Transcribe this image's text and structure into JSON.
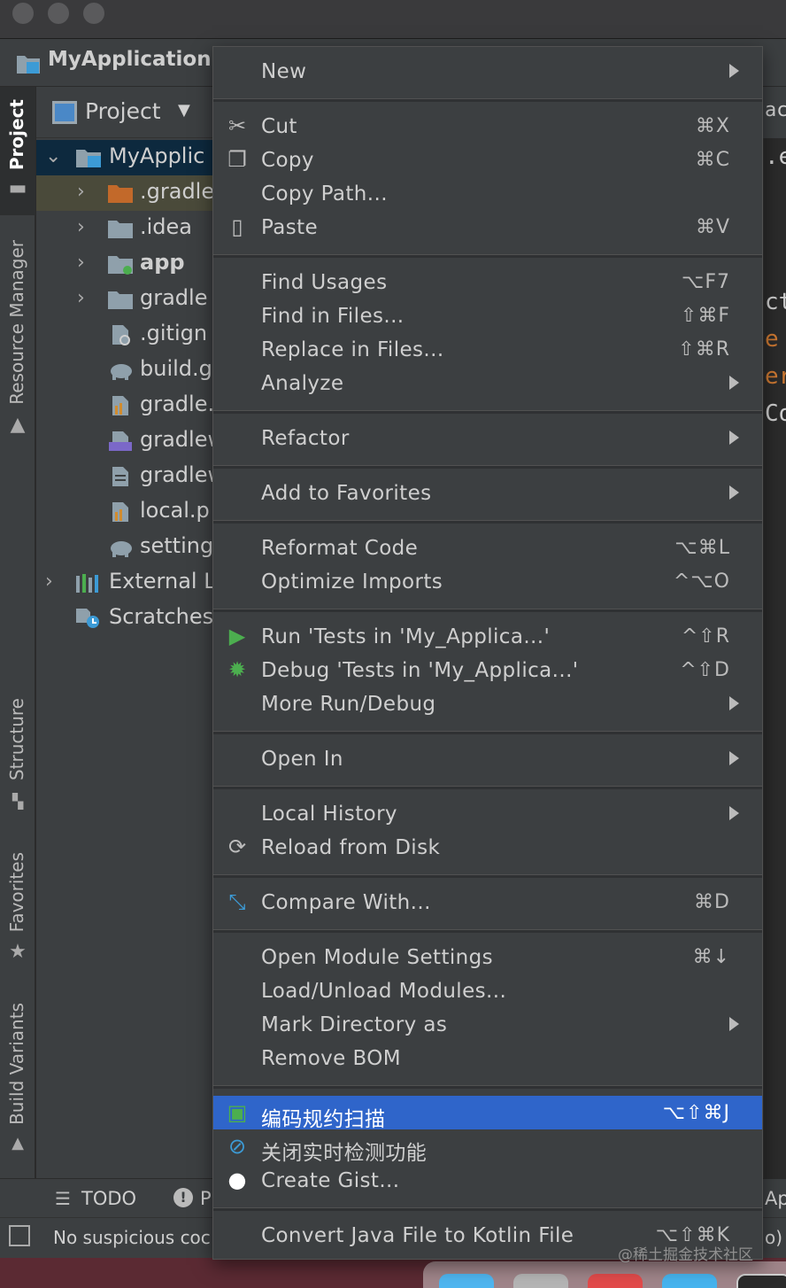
{
  "window": {
    "project_name": "MyApplication"
  },
  "panel": {
    "title": "Project"
  },
  "tool_strip": {
    "project": "Project",
    "resource_manager": "Resource Manager",
    "structure": "Structure",
    "favorites": "Favorites",
    "build_variants": "Build Variants"
  },
  "tree": {
    "root": "MyApplic",
    "gradle_dot": ".gradle",
    "idea": ".idea",
    "app": "app",
    "gradle": "gradle",
    "gitignore": ".gitign",
    "build_gradle": "build.g",
    "gradle_props": "gradle.",
    "gradlew": "gradlew",
    "gradlew_bat": "gradlew",
    "local_props": "local.p",
    "settings": "setting",
    "external": "External L",
    "scratches": "Scratches"
  },
  "editor_fragments": [
    "ac",
    ".e",
    "ct",
    "e",
    "er",
    "Co",
    "Ap",
    "o)"
  ],
  "bottom": {
    "todo": "TODO",
    "problems": "P",
    "status": "No suspicious coc"
  },
  "menu": {
    "new": "New",
    "cut": "Cut",
    "cut_sc": "⌘X",
    "copy": "Copy",
    "copy_sc": "⌘C",
    "copy_path": "Copy Path...",
    "paste": "Paste",
    "paste_sc": "⌘V",
    "find_usages": "Find Usages",
    "find_usages_sc": "⌥F7",
    "find_in_files": "Find in Files...",
    "find_in_files_sc": "⇧⌘F",
    "replace_in_files": "Replace in Files...",
    "replace_in_files_sc": "⇧⌘R",
    "analyze": "Analyze",
    "refactor": "Refactor",
    "add_to_favorites": "Add to Favorites",
    "reformat_code": "Reformat Code",
    "reformat_code_sc": "⌥⌘L",
    "optimize_imports": "Optimize Imports",
    "optimize_imports_sc": "^⌥O",
    "run_tests": "Run 'Tests in 'My_Applica...'",
    "run_tests_sc": "^⇧R",
    "debug_tests": "Debug 'Tests in 'My_Applica...'",
    "debug_tests_sc": "^⇧D",
    "more_run_debug": "More Run/Debug",
    "open_in": "Open In",
    "local_history": "Local History",
    "reload_from_disk": "Reload from Disk",
    "compare_with": "Compare With...",
    "compare_with_sc": "⌘D",
    "open_module_settings": "Open Module Settings",
    "open_module_settings_sc": "⌘↓",
    "load_unload_modules": "Load/Unload Modules...",
    "mark_directory_as": "Mark Directory as",
    "remove_bom": "Remove BOM",
    "code_scan": "编码规约扫描",
    "code_scan_sc": "⌥⇧⌘J",
    "close_realtime": "关闭实时检测功能",
    "create_gist": "Create Gist...",
    "convert_kotlin": "Convert Java File to Kotlin File",
    "convert_kotlin_sc": "⌥⇧⌘K"
  },
  "watermark": "@稀土掘金技术社区",
  "colors": {
    "selection": "#2f65ca",
    "menu_bg": "#3c3f41",
    "editor_bg": "#2b2b2b",
    "folder_orange": "#c2692a",
    "run_green": "#4cae4f"
  }
}
